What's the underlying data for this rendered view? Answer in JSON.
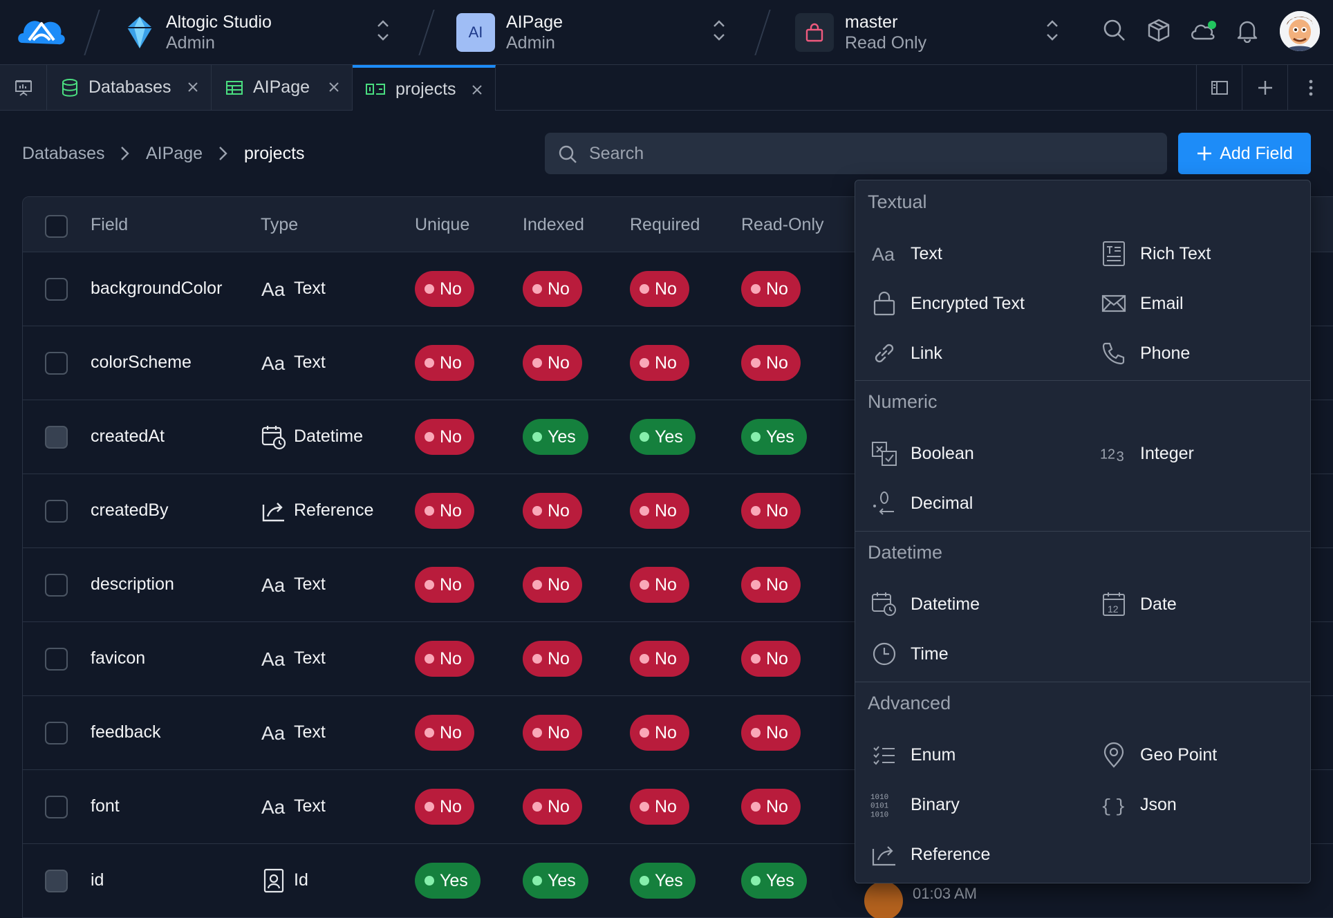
{
  "org": {
    "name": "Altogic Studio",
    "role": "Admin"
  },
  "app": {
    "initials": "AI",
    "name": "AIPage",
    "role": "Admin"
  },
  "env": {
    "name": "master",
    "mode": "Read Only"
  },
  "tabs": [
    {
      "label": "Databases"
    },
    {
      "label": "AIPage"
    },
    {
      "label": "projects"
    }
  ],
  "breadcrumb": [
    "Databases",
    "AIPage",
    "projects"
  ],
  "search": {
    "placeholder": "Search"
  },
  "add_field": "Add Field",
  "columns": [
    "Field",
    "Type",
    "Unique",
    "Indexed",
    "Required",
    "Read-Only"
  ],
  "rows": [
    {
      "field": "backgroundColor",
      "type": "Text",
      "icon": "text-type-icon",
      "unique": "No",
      "indexed": "No",
      "required": "No",
      "readonly": "No"
    },
    {
      "field": "colorScheme",
      "type": "Text",
      "icon": "text-type-icon",
      "unique": "No",
      "indexed": "No",
      "required": "No",
      "readonly": "No"
    },
    {
      "field": "createdAt",
      "type": "Datetime",
      "icon": "datetime-icon",
      "unique": "No",
      "indexed": "Yes",
      "required": "Yes",
      "readonly": "Yes"
    },
    {
      "field": "createdBy",
      "type": "Reference",
      "icon": "reference-icon",
      "unique": "No",
      "indexed": "No",
      "required": "No",
      "readonly": "No"
    },
    {
      "field": "description",
      "type": "Text",
      "icon": "text-type-icon",
      "unique": "No",
      "indexed": "No",
      "required": "No",
      "readonly": "No"
    },
    {
      "field": "favicon",
      "type": "Text",
      "icon": "text-type-icon",
      "unique": "No",
      "indexed": "No",
      "required": "No",
      "readonly": "No"
    },
    {
      "field": "feedback",
      "type": "Text",
      "icon": "text-type-icon",
      "unique": "No",
      "indexed": "No",
      "required": "No",
      "readonly": "No"
    },
    {
      "field": "font",
      "type": "Text",
      "icon": "text-type-icon",
      "unique": "No",
      "indexed": "No",
      "required": "No",
      "readonly": "No"
    },
    {
      "field": "id",
      "type": "Id",
      "icon": "id-icon",
      "unique": "Yes",
      "indexed": "Yes",
      "required": "Yes",
      "readonly": "Yes"
    }
  ],
  "menu": {
    "sections": [
      {
        "title": "Textual",
        "items": [
          "Text",
          "Rich Text",
          "Encrypted Text",
          "Email",
          "Link",
          "Phone"
        ]
      },
      {
        "title": "Numeric",
        "items": [
          "Boolean",
          "Integer",
          "Decimal"
        ]
      },
      {
        "title": "Datetime",
        "items": [
          "Datetime",
          "Date",
          "Time"
        ]
      },
      {
        "title": "Advanced",
        "items": [
          "Enum",
          "Geo Point",
          "Binary",
          "Json",
          "Reference"
        ]
      }
    ]
  },
  "peek_time": "01:03 AM",
  "colors": {
    "accent": "#1d8cf8",
    "no": "#b91c3c",
    "yes": "#15803d",
    "bg": "#111827"
  }
}
